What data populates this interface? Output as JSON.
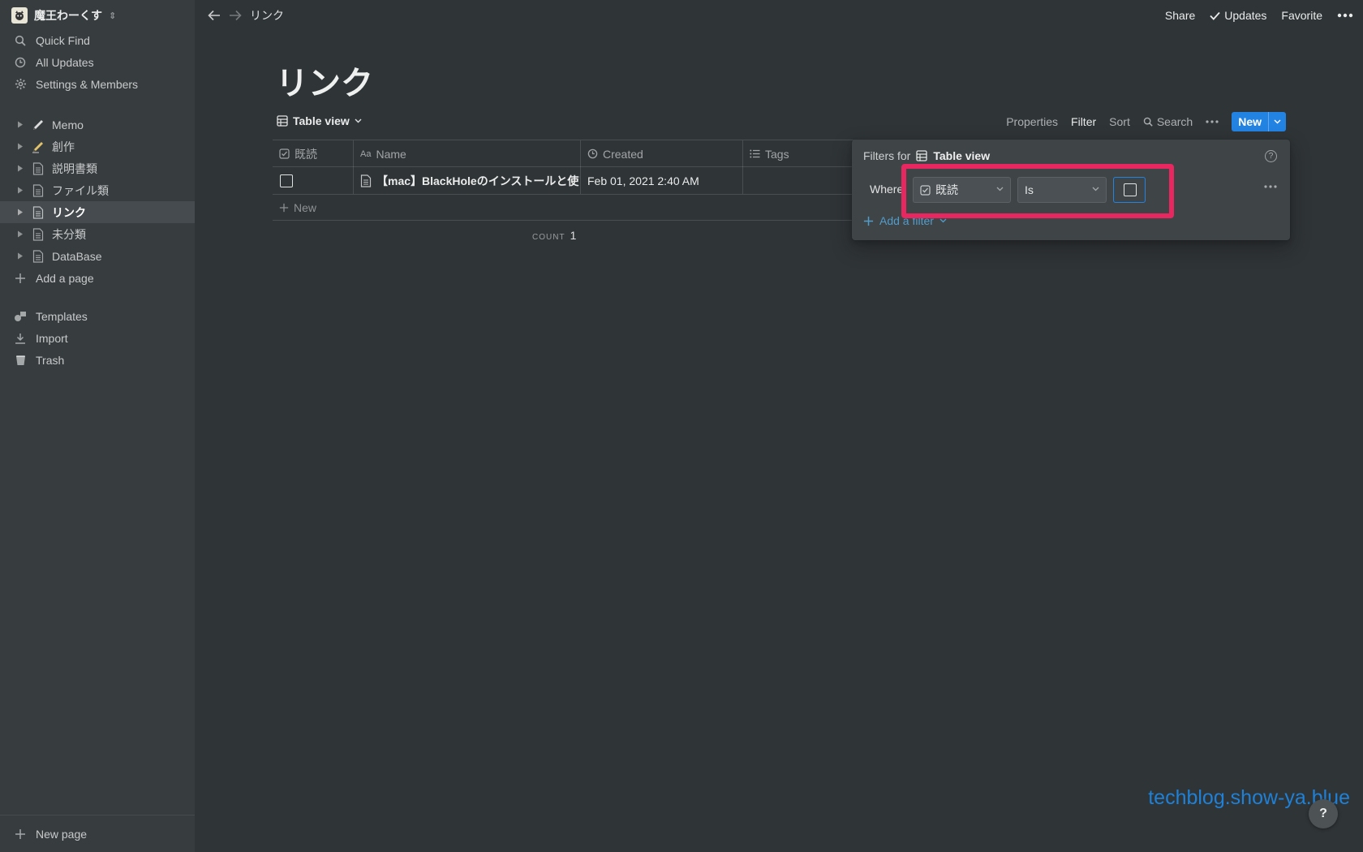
{
  "workspace": {
    "name": "魔王わーくす"
  },
  "sidebar": {
    "top_items": [
      {
        "label": "Quick Find",
        "icon": "search-icon"
      },
      {
        "label": "All Updates",
        "icon": "clock-icon"
      },
      {
        "label": "Settings & Members",
        "icon": "gear-icon"
      }
    ],
    "pages": [
      {
        "label": "Memo",
        "icon": "pen-icon",
        "active": false
      },
      {
        "label": "創作",
        "icon": "pen-icon",
        "active": false
      },
      {
        "label": "説明書類",
        "icon": "page-icon",
        "active": false
      },
      {
        "label": "ファイル類",
        "icon": "page-icon",
        "active": false
      },
      {
        "label": "リンク",
        "icon": "page-icon",
        "active": true
      },
      {
        "label": "未分類",
        "icon": "page-icon",
        "active": false
      },
      {
        "label": "DataBase",
        "icon": "page-icon",
        "active": false
      }
    ],
    "add_page": "Add a page",
    "bottom_items": [
      {
        "label": "Templates",
        "icon": "templates-icon"
      },
      {
        "label": "Import",
        "icon": "import-icon"
      },
      {
        "label": "Trash",
        "icon": "trash-icon"
      }
    ],
    "new_page": "New page"
  },
  "topbar": {
    "breadcrumb": "リンク",
    "share": "Share",
    "updates": "Updates",
    "favorite": "Favorite"
  },
  "page": {
    "title": "リンク"
  },
  "view": {
    "name": "Table view",
    "properties": "Properties",
    "filter": "Filter",
    "sort": "Sort",
    "search": "Search",
    "new": "New"
  },
  "table": {
    "columns": [
      "既読",
      "Name",
      "Created",
      "Tags"
    ],
    "rows": [
      {
        "read": false,
        "name": "【mac】BlackHoleのインストールと使い",
        "created": "Feb 01, 2021 2:40 AM",
        "tags": ""
      }
    ],
    "new_row": "New",
    "count_label": "COUNT",
    "count_value": "1"
  },
  "filter_popup": {
    "title_prefix": "Filters for",
    "view_name": "Table view",
    "where": "Where",
    "property": "既読",
    "operator": "Is",
    "value_checked": false,
    "add_filter": "Add a filter"
  },
  "watermark": "techblog.show-ya.blue",
  "help": "?",
  "colors": {
    "accent": "#2383e2",
    "highlight": "#e8265f",
    "background": "#2f3437",
    "sidebar": "#373c3f"
  }
}
